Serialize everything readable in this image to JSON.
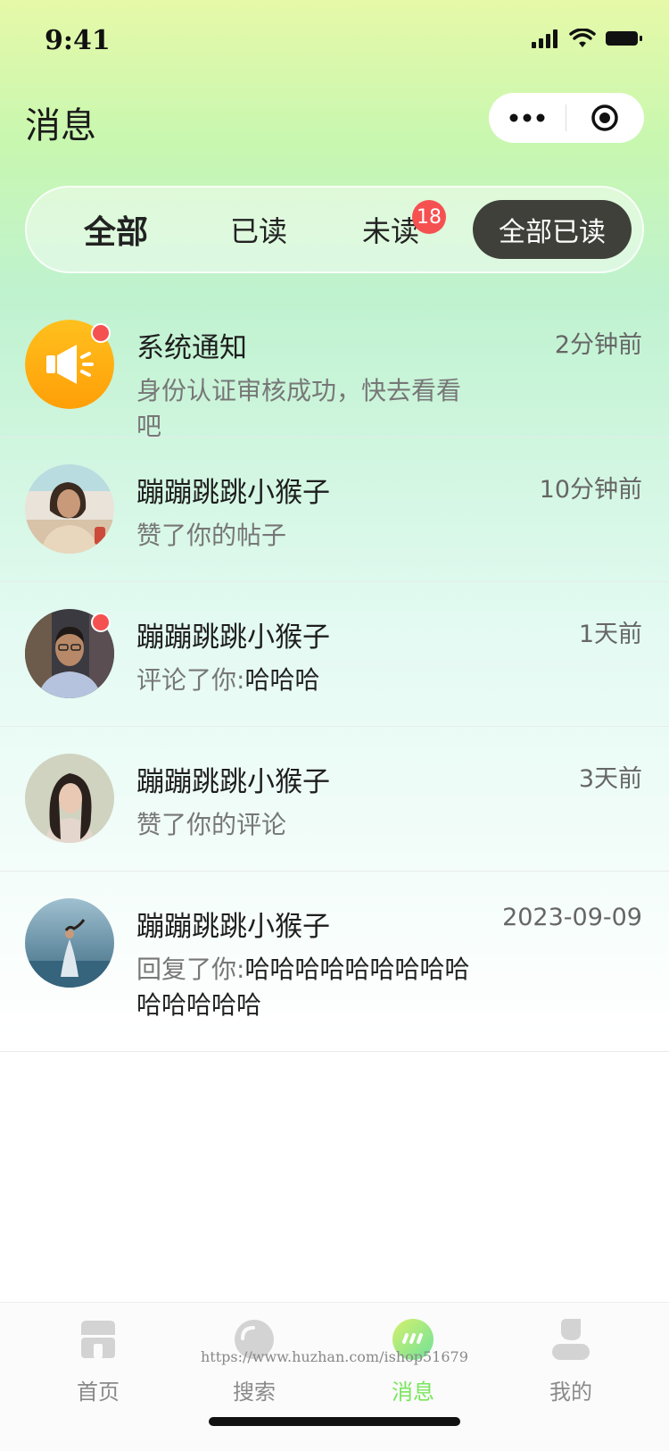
{
  "status_bar": {
    "time": "9:41"
  },
  "header": {
    "title": "消息"
  },
  "tabs": {
    "all": "全部",
    "read": "已读",
    "unread": "未读",
    "unread_count": "18",
    "mark_all_read": "全部已读"
  },
  "messages": [
    {
      "name": "系统通知",
      "time": "2分钟前",
      "content": "身份认证审核成功，快去看看吧",
      "unread": true,
      "avatar": "megaphone-icon"
    },
    {
      "name": "蹦蹦跳跳小猴子",
      "time": "10分钟前",
      "content": "赞了你的帖子",
      "unread": false
    },
    {
      "name": "蹦蹦跳跳小猴子",
      "time": "1天前",
      "content_prefix": "评论了你:",
      "content_highlight": "哈哈哈",
      "unread": true
    },
    {
      "name": "蹦蹦跳跳小猴子",
      "time": "3天前",
      "content": "赞了你的评论",
      "unread": false
    },
    {
      "name": "蹦蹦跳跳小猴子",
      "time": "2023-09-09",
      "content_prefix": "回复了你:",
      "content_highlight": "哈哈哈哈哈哈哈哈哈哈哈哈哈哈",
      "unread": false
    }
  ],
  "tab_bar": {
    "items": [
      {
        "label": "首页",
        "icon": "home-icon"
      },
      {
        "label": "搜索",
        "icon": "search-icon"
      },
      {
        "label": "消息",
        "icon": "message-icon"
      },
      {
        "label": "我的",
        "icon": "profile-icon"
      }
    ],
    "active_index": 2
  },
  "watermark": "https://www.huzhan.com/ishop51679",
  "colors": {
    "accent": "#7ae55e",
    "badge": "#f65151",
    "button_dark": "#3e4039"
  }
}
